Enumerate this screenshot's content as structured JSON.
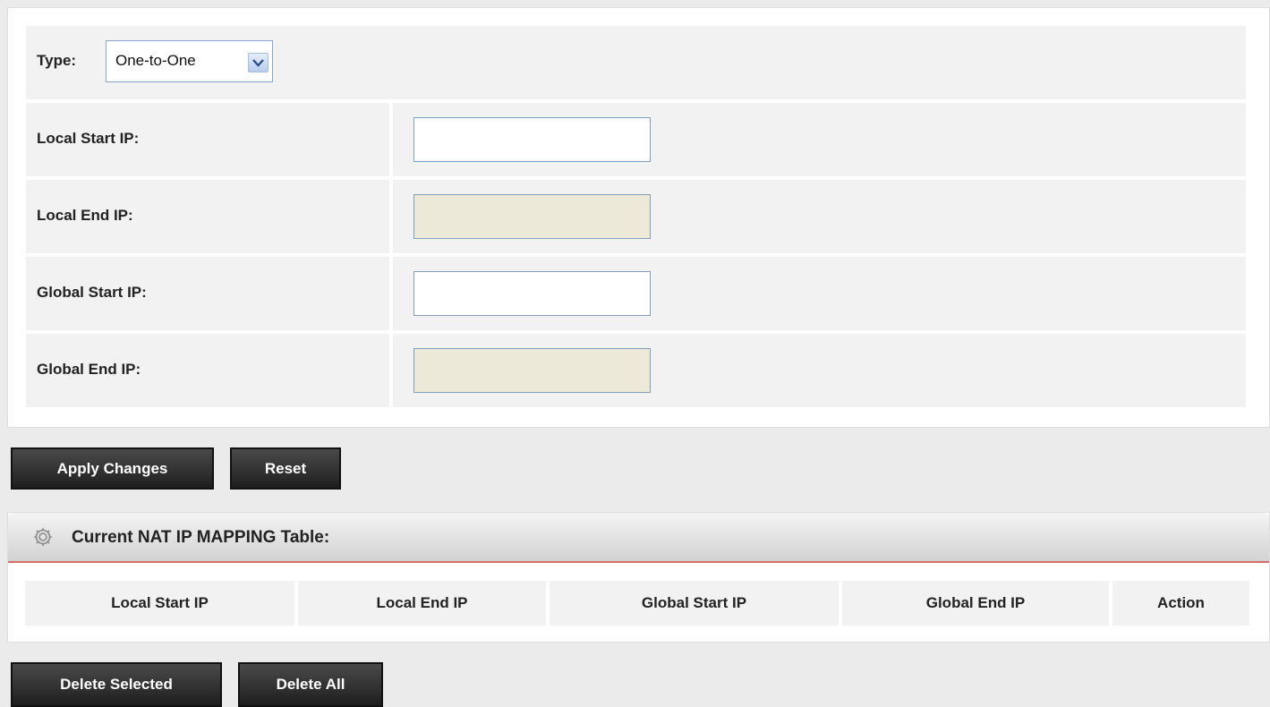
{
  "form": {
    "type_label": "Type:",
    "type_value": "One-to-One",
    "fields": [
      {
        "label": "Local Start IP:",
        "value": "",
        "disabled": false
      },
      {
        "label": "Local End IP:",
        "value": "",
        "disabled": true
      },
      {
        "label": "Global Start IP:",
        "value": "",
        "disabled": false
      },
      {
        "label": "Global End IP:",
        "value": "",
        "disabled": true
      }
    ]
  },
  "buttons": {
    "apply": "Apply Changes",
    "reset": "Reset",
    "delete_selected": "Delete Selected",
    "delete_all": "Delete All"
  },
  "table": {
    "title": "Current NAT IP MAPPING Table:",
    "icon": "gear-icon",
    "columns": [
      "Local Start IP",
      "Local End IP",
      "Global Start IP",
      "Global End IP",
      "Action"
    ],
    "rows": []
  },
  "colors": {
    "accent_line": "#d96a6a",
    "button_bg": "#2a2a2a",
    "disabled_input": "#ece9d8"
  }
}
